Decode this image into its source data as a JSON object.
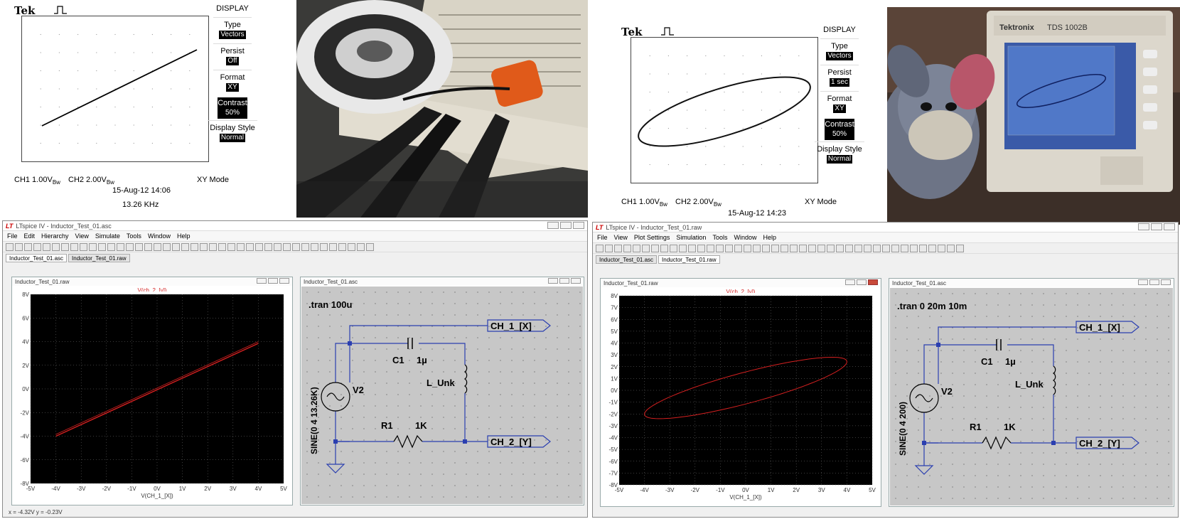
{
  "scope_left": {
    "brand": "Tek",
    "menu_title": "DISPLAY",
    "items": [
      {
        "label": "Type",
        "value": "Vectors"
      },
      {
        "label": "Persist",
        "value": "Off"
      },
      {
        "label": "Format",
        "value": "XY"
      },
      {
        "label": "Contrast",
        "value": "50%"
      },
      {
        "label": "Display Style",
        "value": "Normal"
      }
    ],
    "ch1": "CH1  1.00V",
    "ch1_unit": "Bw",
    "ch2": "CH2  2.00V",
    "ch2_unit": "Bw",
    "mode": "XY Mode",
    "timestamp": "15-Aug-12 14:06",
    "frequency": "13.26 KHz"
  },
  "scope_right": {
    "brand": "Tek",
    "menu_title": "DISPLAY",
    "items": [
      {
        "label": "Type",
        "value": "Vectors"
      },
      {
        "label": "Persist",
        "value": "1 sec"
      },
      {
        "label": "Format",
        "value": "XY"
      },
      {
        "label": "Contrast",
        "value": "50%"
      },
      {
        "label": "Display Style",
        "value": "Normal"
      }
    ],
    "ch1": "CH1  1.00V",
    "ch1_unit": "Bw",
    "ch2": "CH2  2.00V",
    "ch2_unit": "Bw",
    "mode": "XY Mode",
    "timestamp": "15-Aug-12 14:23"
  },
  "photo_right": {
    "brand": "Tektronix",
    "model": "TDS 1002B"
  },
  "lt_left": {
    "app_title": "LTspice IV - Inductor_Test_01.asc",
    "menus": [
      "File",
      "Edit",
      "Hierarchy",
      "View",
      "Simulate",
      "Tools",
      "Window",
      "Help"
    ],
    "tabs": [
      "Inductor_Test_01.asc",
      "Inductor_Test_01.raw"
    ],
    "plot_title": "Inductor_Test_01.raw",
    "trace": "V(ch_2_[y])",
    "x_label": "V(CH_1_[X])",
    "y_ticks": [
      "8V",
      "6V",
      "4V",
      "2V",
      "0V",
      "-2V",
      "-4V",
      "-6V",
      "-8V"
    ],
    "x_ticks": [
      "-5V",
      "-4V",
      "-3V",
      "-2V",
      "-1V",
      "0V",
      "1V",
      "2V",
      "3V",
      "4V",
      "5V"
    ],
    "schem_title": "Inductor_Test_01.asc",
    "directive": ".tran 100u",
    "source_name": "V2",
    "source_value": "SINE(0 4 13.26K)",
    "net1": "CH_1_[X]",
    "net2": "CH_2_[Y]",
    "c_name": "C1",
    "c_value": "1µ",
    "l_name": "L_Unk",
    "r_name": "R1",
    "r_value": "1K",
    "status": "x = -4.32V   y = -0.23V"
  },
  "lt_right": {
    "app_title": "LTspice IV - Inductor_Test_01.raw",
    "menus": [
      "File",
      "View",
      "Plot Settings",
      "Simulation",
      "Tools",
      "Window",
      "Help"
    ],
    "tabs": [
      "Inductor_Test_01.asc",
      "Inductor_Test_01.raw"
    ],
    "plot_title": "Inductor_Test_01.raw",
    "trace": "V(ch_2_[y])",
    "x_label": "V(CH_1_[X])",
    "y_ticks": [
      "8V",
      "7V",
      "6V",
      "5V",
      "4V",
      "3V",
      "2V",
      "1V",
      "0V",
      "-1V",
      "-2V",
      "-3V",
      "-4V",
      "-5V",
      "-6V",
      "-7V",
      "-8V"
    ],
    "x_ticks": [
      "-5V",
      "-4V",
      "-3V",
      "-2V",
      "-1V",
      "0V",
      "1V",
      "2V",
      "3V",
      "4V",
      "5V"
    ],
    "schem_title": "Inductor_Test_01.asc",
    "directive": ".tran 0 20m 10m",
    "source_name": "V2",
    "source_value": "SINE(0 4 200)",
    "net1": "CH_1_[X]",
    "net2": "CH_2_[Y]",
    "c_name": "C1",
    "c_value": "1µ",
    "l_name": "L_Unk",
    "r_name": "R1",
    "r_value": "1K"
  },
  "colors": {
    "trace_red": "#d42020",
    "wire_blue": "#2b3fb0",
    "schem_bg": "#c7c7c7",
    "plot_bg": "#000000"
  }
}
